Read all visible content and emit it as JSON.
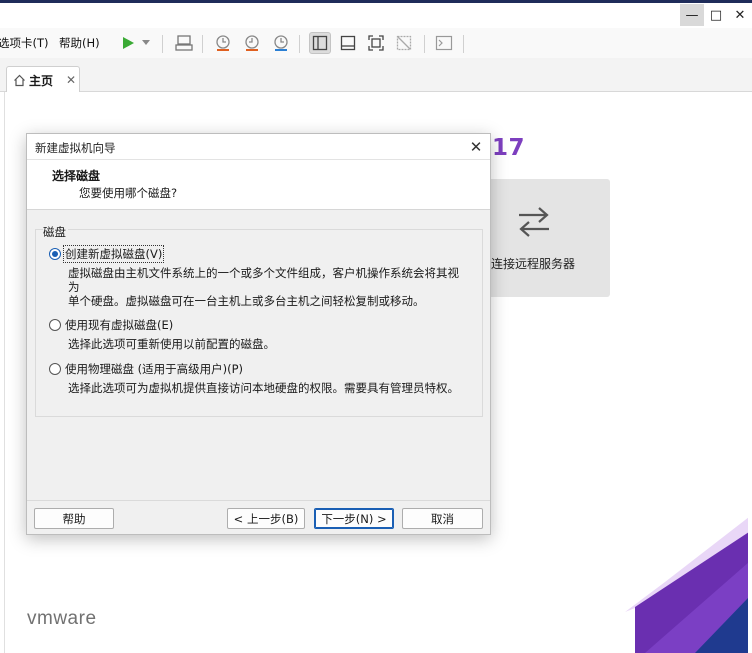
{
  "window": {
    "minimize_glyph": "—",
    "maximize_glyph": "□",
    "close_glyph": "✕"
  },
  "menu": {
    "tabs_label": "选项卡(T)",
    "help_label": "帮助(H)"
  },
  "toolbar": {
    "icons": [
      "play-icon",
      "dropdown-arrow-icon",
      "send-keys-icon",
      "snapshot-icon",
      "revert-snapshot-icon",
      "snapshot-manager-icon",
      "library-view-icon",
      "console-view-icon",
      "fullscreen-icon",
      "unity-icon",
      "terminal-icon"
    ]
  },
  "tabs": [
    {
      "label": "主页",
      "close_glyph": "✕"
    }
  ],
  "home": {
    "version": "17",
    "remote_label": "连接远程服务器",
    "logo_text": "vmware",
    "colors": {
      "version": "#7d3fbf",
      "card": "#e4e4e4",
      "accent_purple": "#6a2fb0",
      "accent_blue": "#1f3a8f"
    }
  },
  "dialog": {
    "title": "新建虚拟机向导",
    "heading": "选择磁盘",
    "subheading": "您要使用哪个磁盘?",
    "group_label": "磁盘",
    "options": [
      {
        "label": "创建新虚拟磁盘(V)",
        "checked": true,
        "desc": [
          "虚拟磁盘由主机文件系统上的一个或多个文件组成，客户机操作系统会将其视为",
          "单个硬盘。虚拟磁盘可在一台主机上或多台主机之间轻松复制或移动。"
        ]
      },
      {
        "label": "使用现有虚拟磁盘(E)",
        "checked": false,
        "desc": [
          "选择此选项可重新使用以前配置的磁盘。"
        ]
      },
      {
        "label": "使用物理磁盘 (适用于高级用户)(P)",
        "checked": false,
        "desc": [
          "选择此选项可为虚拟机提供直接访问本地硬盘的权限。需要具有管理员特权。"
        ]
      }
    ],
    "buttons": {
      "help": "帮助",
      "back": "< 上一步(B)",
      "next": "下一步(N) >",
      "cancel": "取消"
    }
  }
}
